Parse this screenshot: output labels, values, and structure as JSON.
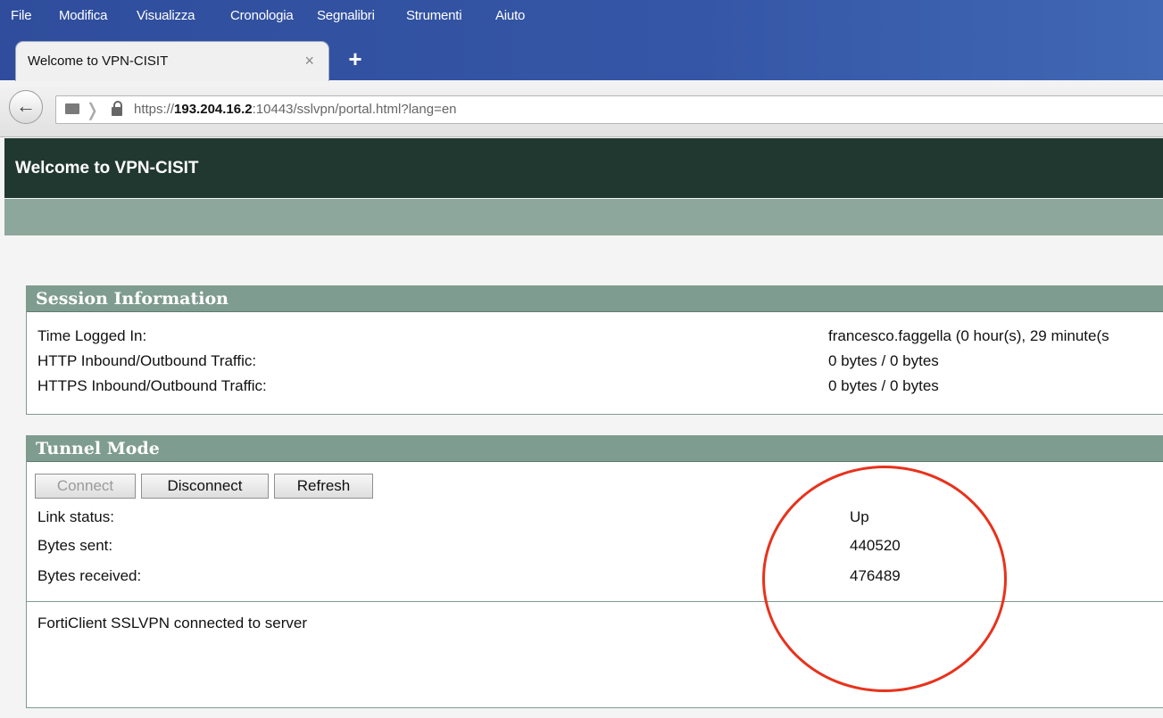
{
  "browser": {
    "menu": [
      "File",
      "Modifica",
      "Visualizza",
      "Cronologia",
      "Segnalibri",
      "Strumenti",
      "Aiuto"
    ],
    "tab_title": "Welcome to VPN-CISIT",
    "tab_close": "×",
    "new_tab": "+",
    "url_prefix": "https://",
    "url_host": "193.204.16.2",
    "url_rest": ":10443/sslvpn/portal.html?lang=en"
  },
  "page": {
    "title": "Welcome to VPN-CISIT"
  },
  "session": {
    "heading": "Session Information",
    "rows": [
      {
        "label": "Time Logged In:",
        "value": "francesco.faggella (0 hour(s), 29 minute(s"
      },
      {
        "label": "HTTP Inbound/Outbound Traffic:",
        "value": "0 bytes / 0 bytes"
      },
      {
        "label": "HTTPS Inbound/Outbound Traffic:",
        "value": "0 bytes / 0 bytes"
      }
    ]
  },
  "tunnel": {
    "heading": "Tunnel Mode",
    "buttons": {
      "connect": "Connect",
      "disconnect": "Disconnect",
      "refresh": "Refresh"
    },
    "rows": [
      {
        "label": "Link status:",
        "value": "Up"
      },
      {
        "label": "Bytes sent:",
        "value": "440520"
      },
      {
        "label": "Bytes received:",
        "value": "476489"
      }
    ],
    "message": "FortiClient SSLVPN connected to server"
  },
  "annotation_color": "#e8321c"
}
